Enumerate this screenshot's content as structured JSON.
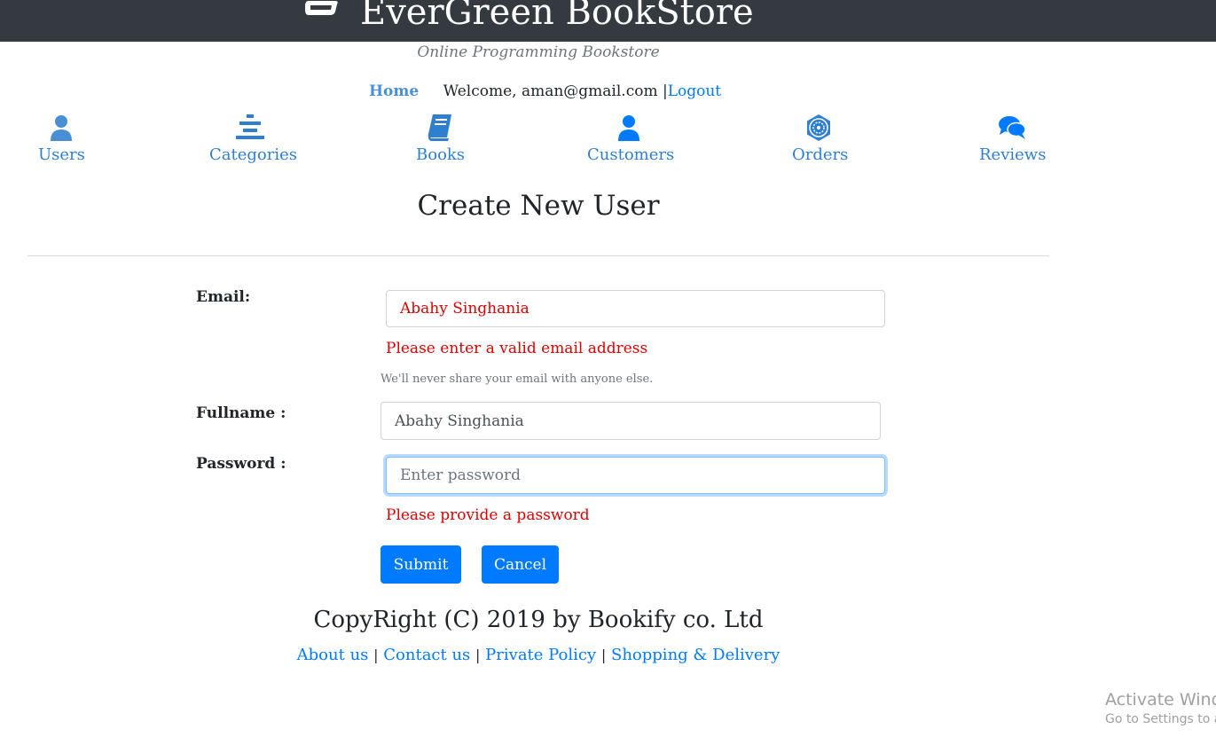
{
  "header": {
    "brand": "EverGreen BookStore",
    "brand_icon": "book-icon",
    "tagline": "Online Programming Bookstore"
  },
  "userbar": {
    "home": "Home",
    "welcome": "Welcome, aman@gmail.com |",
    "logout": "Logout"
  },
  "menu": [
    {
      "label": "Users",
      "icon": "user-icon"
    },
    {
      "label": "Categories",
      "icon": "categories-icon"
    },
    {
      "label": "Books",
      "icon": "book-icon"
    },
    {
      "label": "Customers",
      "icon": "customer-icon"
    },
    {
      "label": "Orders",
      "icon": "orders-icon"
    },
    {
      "label": "Reviews",
      "icon": "comments-icon"
    }
  ],
  "form": {
    "title": "Create New User",
    "email_label": "Email:",
    "email_value": "Abahy Singhania",
    "email_error": "Please enter a valid email address",
    "email_help": "We'll never share your email with anyone else.",
    "fullname_label": "Fullname :",
    "fullname_value": "Abahy Singhania",
    "password_label": "Password :",
    "password_placeholder": "Enter password",
    "password_error": "Please provide a password",
    "submit": "Submit",
    "cancel": "Cancel"
  },
  "footer": {
    "copyright": "CopyRight (C) 2019 by Bookify co. Ltd",
    "links": [
      "About us",
      "Contact us",
      "Private Policy",
      "Shopping & Delivery"
    ],
    "separator": "|"
  },
  "watermark": {
    "line1": "Activate Windo",
    "line2": "Go to Settings to a"
  },
  "colors": {
    "header_bg": "#343a40",
    "primary": "#007bff",
    "error": "#dc0000"
  }
}
